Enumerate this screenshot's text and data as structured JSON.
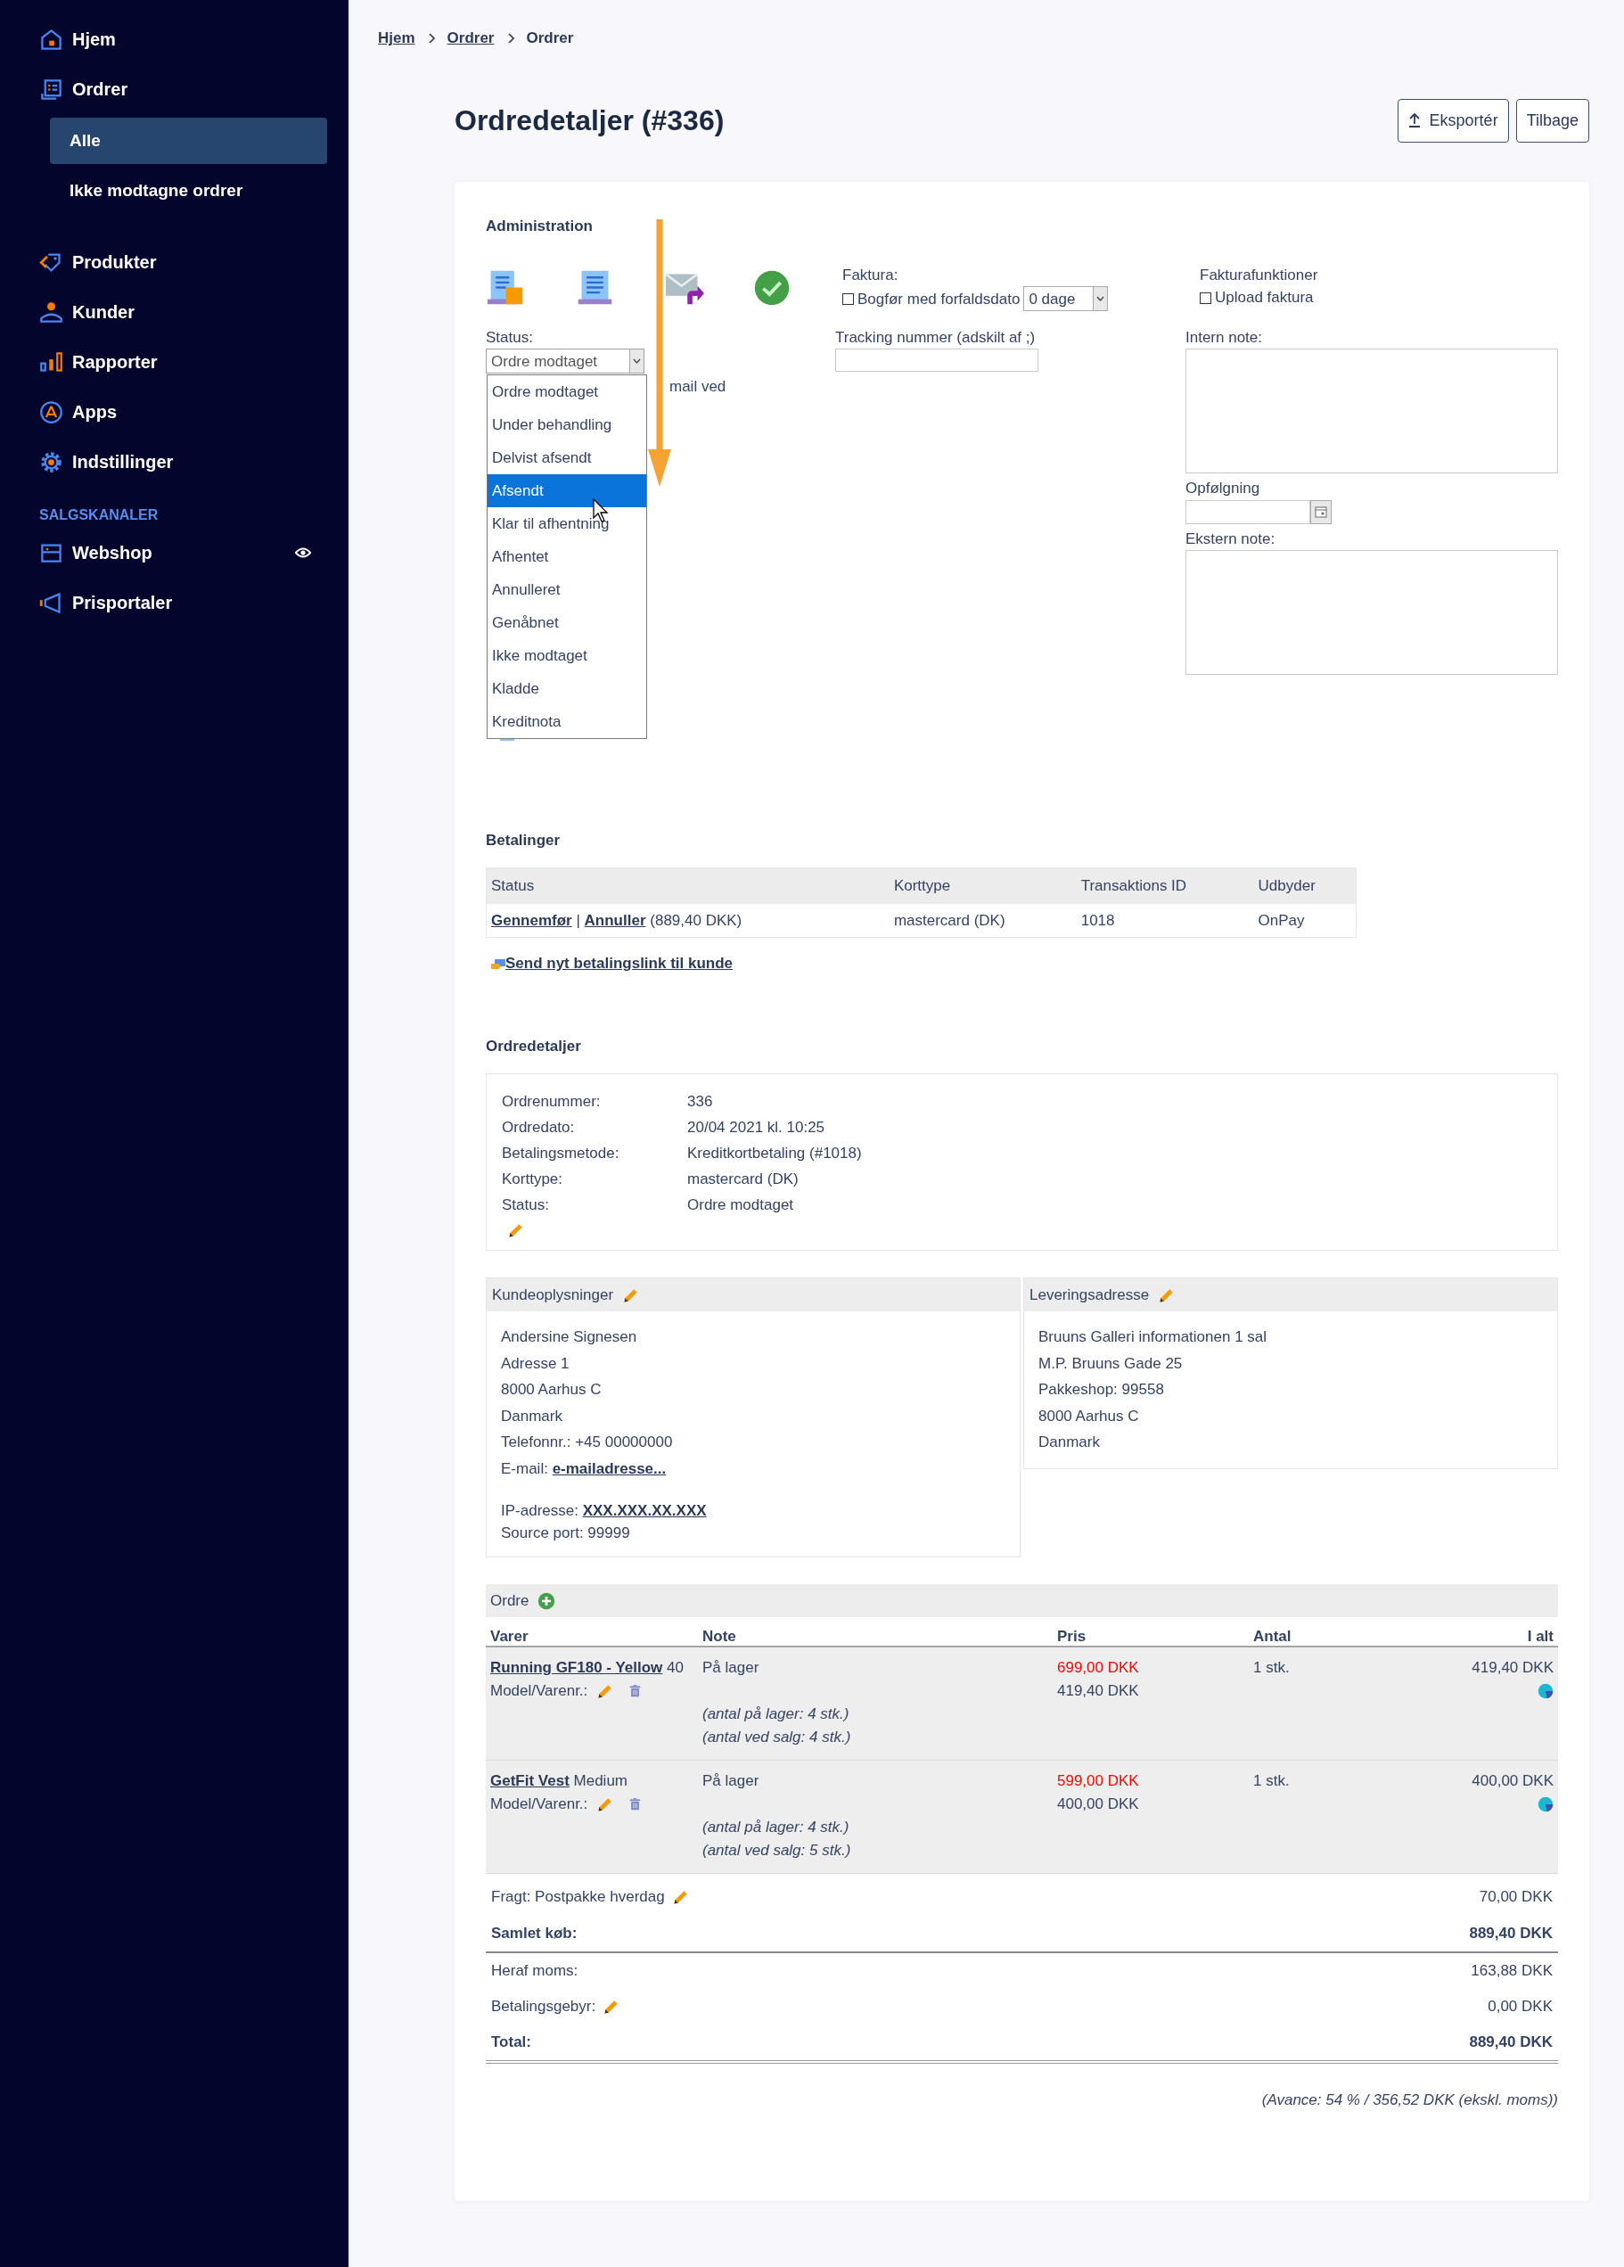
{
  "sidebar": {
    "items": [
      {
        "label": "Hjem",
        "selected": false
      },
      {
        "label": "Ordrer",
        "selected": false,
        "children": [
          {
            "label": "Alle",
            "selected": true
          },
          {
            "label": "Ikke modtagne ordrer",
            "selected": false
          }
        ]
      },
      {
        "label": "Produkter",
        "selected": false
      },
      {
        "label": "Kunder",
        "selected": false
      },
      {
        "label": "Rapporter",
        "selected": false
      },
      {
        "label": "Apps",
        "selected": false
      },
      {
        "label": "Indstillinger",
        "selected": false
      }
    ],
    "section": {
      "title": "SALGSKANALER",
      "items": [
        {
          "label": "Webshop",
          "selected": false
        },
        {
          "label": "Prisportaler",
          "selected": false
        }
      ]
    }
  },
  "breadcrumb": [
    {
      "label": "Hjem",
      "link": true
    },
    {
      "label": "Ordrer",
      "link": true
    },
    {
      "label": "Ordrer",
      "link": false
    }
  ],
  "page_title": "Ordredetaljer (#336)",
  "header_buttons": [
    "Eksportér",
    "Tilbage"
  ],
  "administration": {
    "title": "Administration",
    "status_label": "Status:",
    "status_value": "Ordre modtaget",
    "status_options": [
      {
        "label": "Ordre modtaget",
        "selected": false
      },
      {
        "label": "Under behandling",
        "selected": false
      },
      {
        "label": "Delvist afsendt",
        "selected": false
      },
      {
        "label": "Afsendt",
        "selected": true
      },
      {
        "label": "Klar til afhentning",
        "selected": false
      },
      {
        "label": "Afhentet",
        "selected": false
      },
      {
        "label": "Annulleret",
        "selected": false
      },
      {
        "label": "Genåbnet",
        "selected": false
      },
      {
        "label": "Ikke modtaget",
        "selected": false
      },
      {
        "label": "Kladde",
        "selected": false
      },
      {
        "label": "Kreditnota",
        "selected": false
      }
    ],
    "partial_text": "mail ved",
    "faktura": {
      "label": "Faktura:",
      "checkbox": {
        "label": "Bogfør med forfaldsdato",
        "checked": false
      },
      "days": "0 dage"
    },
    "fakturafunktioner": {
      "label": "Fakturafunktioner",
      "checkbox": {
        "label": "Upload faktura",
        "checked": false
      }
    },
    "tracking_label": "Tracking nummer (adskilt af ;)",
    "intern_note_label": "Intern note:",
    "followup_label": "Opfølgning",
    "ekstern_note_label": "Ekstern note:"
  },
  "payments": {
    "title": "Betalinger",
    "columns": [
      "Status",
      "Korttype",
      "Transaktions ID",
      "Udbyder"
    ],
    "rows": [
      {
        "status": [
          {
            "text": "Gennemfør",
            "link": true
          },
          {
            "text": "|",
            "link": false
          },
          {
            "text": "Annuller",
            "link": true
          },
          {
            "text": "(889,40 DKK)",
            "link": false
          }
        ],
        "card": "mastercard (DK)",
        "transaction_id": "1018",
        "provider": "OnPay"
      }
    ],
    "send_link": "Send nyt betalingslink til kunde"
  },
  "order_details": {
    "title": "Ordredetaljer",
    "fields": [
      {
        "label": "Ordrenummer:",
        "value": "336"
      },
      {
        "label": "Ordredato:",
        "value": "20/04 2021 kl. 10:25"
      },
      {
        "label": "Betalingsmetode:",
        "value": "Kreditkortbetaling (#1018)"
      },
      {
        "label": "Korttype:",
        "value": "mastercard (DK)"
      },
      {
        "label": "Status:",
        "value": "Ordre modtaget"
      }
    ]
  },
  "customer": {
    "title": "Kundeoplysninger",
    "lines": [
      {
        "kind": "text",
        "text": "Andersine Signesen"
      },
      {
        "kind": "text",
        "text": "Adresse 1"
      },
      {
        "kind": "text",
        "text": "8000 Aarhus C"
      },
      {
        "kind": "text",
        "text": "Danmark"
      },
      {
        "kind": "text",
        "text": "Telefonnr.: +45 00000000"
      },
      {
        "kind": "link",
        "label": "E-mail:",
        "text": "e-mailadresse..."
      }
    ],
    "network": [
      {
        "kind": "link",
        "label": "IP-adresse:",
        "text": "XXX.XXX.XX.XXX"
      },
      {
        "kind": "text",
        "text": "Source port: 99999"
      }
    ]
  },
  "delivery": {
    "title": "Leveringsadresse",
    "lines": [
      "Bruuns Galleri informationen 1 sal",
      "M.P. Bruuns Gade 25",
      "Pakkeshop: 99558",
      "8000 Aarhus C",
      "Danmark"
    ]
  },
  "order": {
    "title": "Ordre",
    "columns": [
      "Varer",
      "Note",
      "Pris",
      "Antal",
      "I alt"
    ],
    "rows": [
      {
        "product": "Running GF180 - Yellow",
        "variant": "40",
        "model_label": "Model/Varenr.:",
        "note": "På lager",
        "stock_notes": [
          "(antal på lager: 4 stk.)",
          "(antal ved salg: 4 stk.)"
        ],
        "list_price": "699,00 DKK",
        "price": "419,40 DKK",
        "quantity": "1 stk.",
        "total": "419,40 DKK"
      },
      {
        "product": "GetFit Vest",
        "variant": "Medium",
        "model_label": "Model/Varenr.:",
        "note": "På lager",
        "stock_notes": [
          "(antal på lager: 4 stk.)",
          "(antal ved salg: 5 stk.)"
        ],
        "list_price": "599,00 DKK",
        "price": "400,00 DKK",
        "quantity": "1 stk.",
        "total": "400,00 DKK"
      }
    ],
    "totals": [
      {
        "kind": "editable",
        "label": "Fragt: Postpakke hverdag",
        "value": "70,00 DKK"
      },
      {
        "kind": "subtotal",
        "label": "Samlet køb:",
        "value": "889,40 DKK"
      },
      {
        "kind": "plain",
        "label": "Heraf moms:",
        "value": "163,88 DKK"
      },
      {
        "kind": "editable",
        "label": "Betalingsgebyr:",
        "value": "0,00 DKK"
      },
      {
        "kind": "total",
        "label": "Total:",
        "value": "889,40 DKK"
      }
    ],
    "margin_note": "(Avance: 54 % / 356,52 DKK (ekskl. moms))"
  }
}
